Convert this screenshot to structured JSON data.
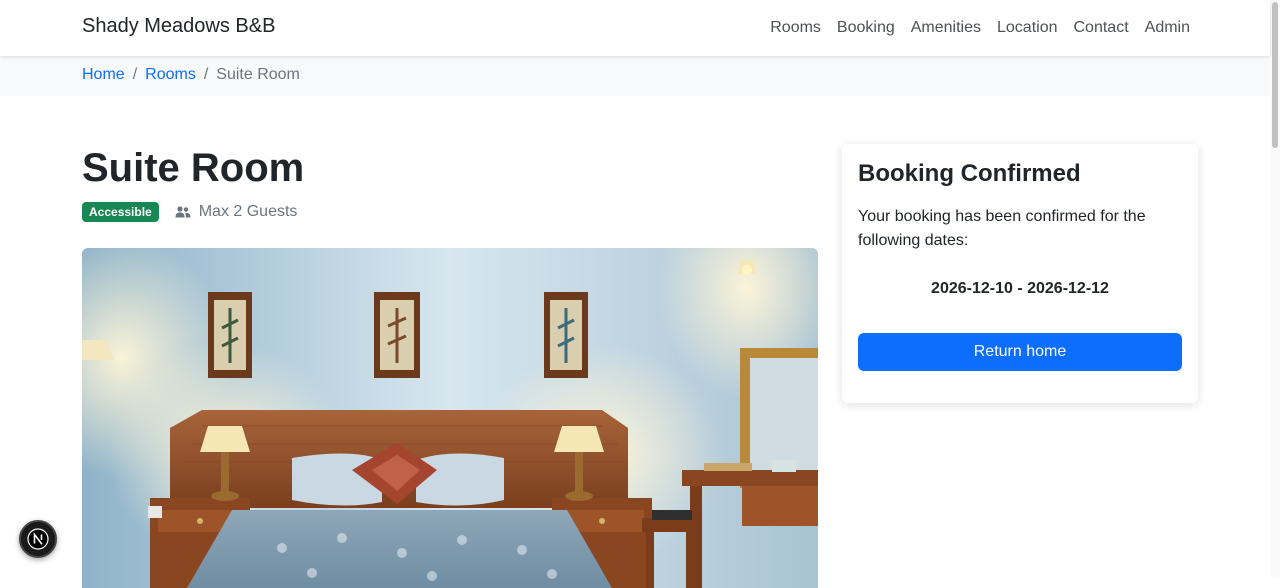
{
  "navbar": {
    "brand": "Shady Meadows B&B",
    "links": [
      "Rooms",
      "Booking",
      "Amenities",
      "Location",
      "Contact",
      "Admin"
    ]
  },
  "breadcrumb": {
    "home": "Home",
    "rooms": "Rooms",
    "current": "Suite Room",
    "separator": "/"
  },
  "room": {
    "title": "Suite Room",
    "badge": "Accessible",
    "guests": "Max 2 Guests",
    "image_icon": "bedroom-photo"
  },
  "booking_card": {
    "title": "Booking Confirmed",
    "message": "Your booking has been confirmed for the following dates:",
    "dates": "2026-12-10 - 2026-12-12",
    "button_label": "Return home"
  },
  "icons": {
    "guests": "people-icon",
    "dev_badge": "nextjs-icon"
  },
  "colors": {
    "primary": "#0d6efd",
    "success": "#198754",
    "muted": "#6c757d",
    "crumb_bg": "#f8f9fa"
  }
}
